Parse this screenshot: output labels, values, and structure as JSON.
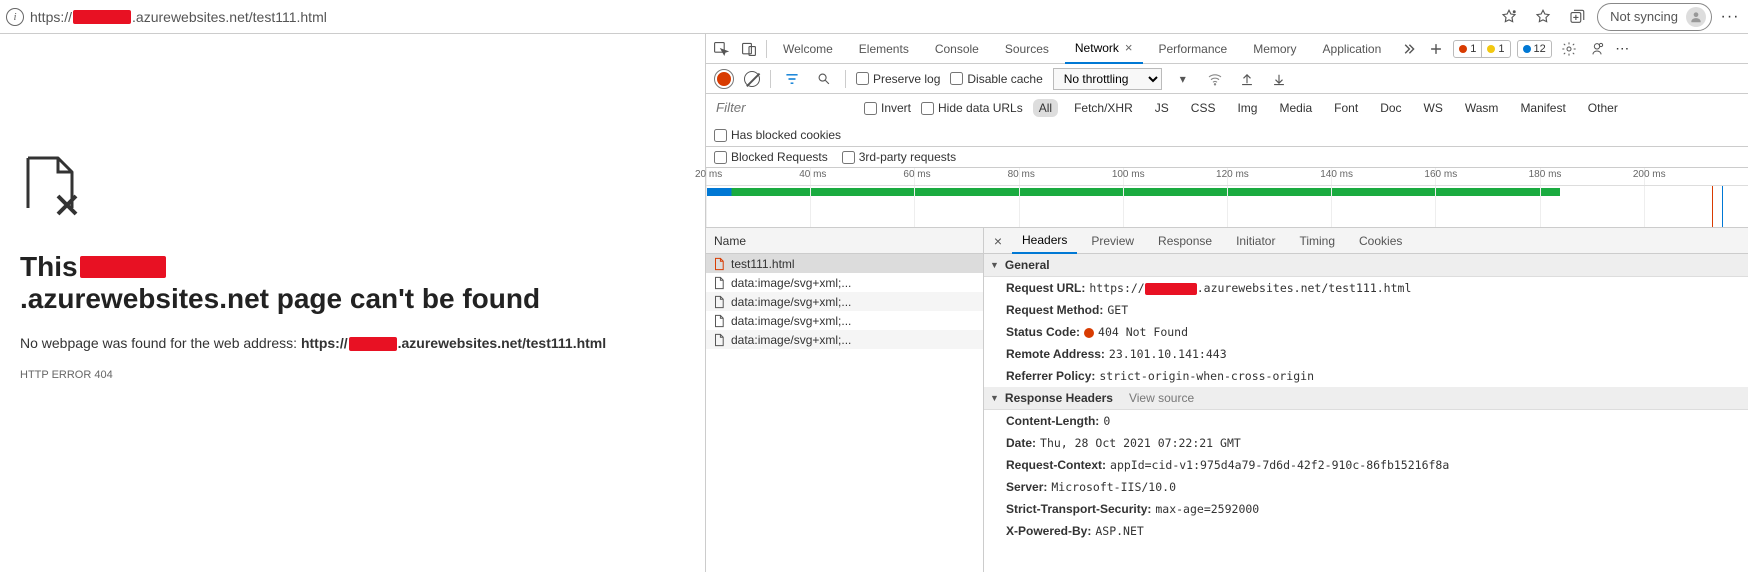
{
  "url": {
    "prefix": "https://",
    "suffix": ".azurewebsites.net/test111.html"
  },
  "topbar": {
    "not_syncing": "Not syncing",
    "more": "···"
  },
  "page": {
    "title_pre": "This ",
    "title_post": ".azurewebsites.net page can't be found",
    "sub_pre": "No webpage was found for the web address: ",
    "sub_bold_pre": "https://",
    "sub_bold_post": ".azurewebsites.net/test111.html",
    "http_error": "HTTP ERROR 404"
  },
  "devtools": {
    "tabs": {
      "welcome": "Welcome",
      "elements": "Elements",
      "console": "Console",
      "sources": "Sources",
      "network": "Network",
      "performance": "Performance",
      "memory": "Memory",
      "application": "Application"
    },
    "badges": {
      "errors": "1",
      "warnings": "1",
      "info": "12"
    }
  },
  "nettb": {
    "preserve": "Preserve log",
    "disable_cache": "Disable cache",
    "throttle": "No throttling"
  },
  "filter": {
    "placeholder": "Filter",
    "invert": "Invert",
    "hide_data": "Hide data URLs",
    "types": {
      "all": "All",
      "fetch": "Fetch/XHR",
      "js": "JS",
      "css": "CSS",
      "img": "Img",
      "media": "Media",
      "font": "Font",
      "doc": "Doc",
      "ws": "WS",
      "wasm": "Wasm",
      "manifest": "Manifest",
      "other": "Other"
    },
    "blocked_cookies": "Has blocked cookies",
    "blocked_req": "Blocked Requests",
    "third_party": "3rd-party requests"
  },
  "timeline": {
    "ticks": [
      "20 ms",
      "40 ms",
      "60 ms",
      "80 ms",
      "100 ms",
      "120 ms",
      "140 ms",
      "160 ms",
      "180 ms",
      "200 ms"
    ]
  },
  "requests": {
    "col_name": "Name",
    "rows": [
      {
        "name": "test111.html",
        "type": "doc"
      },
      {
        "name": "data:image/svg+xml;...",
        "type": "img"
      },
      {
        "name": "data:image/svg+xml;...",
        "type": "img"
      },
      {
        "name": "data:image/svg+xml;...",
        "type": "img"
      },
      {
        "name": "data:image/svg+xml;...",
        "type": "img"
      }
    ]
  },
  "detail": {
    "tabs": {
      "headers": "Headers",
      "preview": "Preview",
      "response": "Response",
      "initiator": "Initiator",
      "timing": "Timing",
      "cookies": "Cookies"
    },
    "general": {
      "title": "General",
      "url_k": "Request URL:",
      "url_pre": "https://",
      "url_post": ".azurewebsites.net/test111.html",
      "method_k": "Request Method:",
      "method_v": "GET",
      "status_k": "Status Code:",
      "status_v": "404 Not Found",
      "remote_k": "Remote Address:",
      "remote_v": "23.101.10.141:443",
      "referrer_k": "Referrer Policy:",
      "referrer_v": "strict-origin-when-cross-origin"
    },
    "resp": {
      "title": "Response Headers",
      "viewsrc": "View source",
      "cl_k": "Content-Length:",
      "cl_v": "0",
      "date_k": "Date:",
      "date_v": "Thu, 28 Oct 2021 07:22:21 GMT",
      "rc_k": "Request-Context:",
      "rc_v": "appId=cid-v1:975d4a79-7d6d-42f2-910c-86fb15216f8a",
      "srv_k": "Server:",
      "srv_v": "Microsoft-IIS/10.0",
      "sts_k": "Strict-Transport-Security:",
      "sts_v": "max-age=2592000",
      "xpb_k": "X-Powered-By:",
      "xpb_v": "ASP.NET"
    }
  }
}
